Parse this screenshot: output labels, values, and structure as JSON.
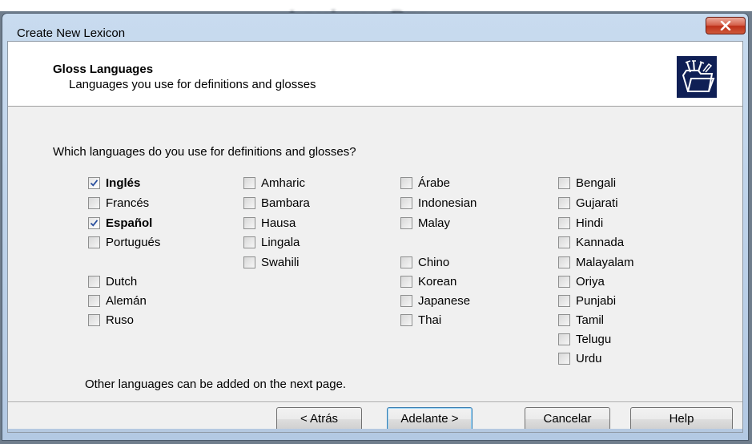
{
  "background": {
    "app_title": "Lexique Pro"
  },
  "window": {
    "title": "Create New Lexicon",
    "close_icon": "close-icon"
  },
  "header": {
    "title": "Gloss Languages",
    "subtitle": "Languages you use for definitions and glosses",
    "icon": "wizard-folder-icon"
  },
  "question": "Which languages do you use for definitions and glosses?",
  "languages": [
    {
      "label": "Inglés",
      "checked": true,
      "bold": true
    },
    {
      "label": "Francés",
      "checked": false
    },
    {
      "label": "Español",
      "checked": true,
      "bold": true
    },
    {
      "label": "Portugués",
      "checked": false
    },
    {
      "label": "Dutch",
      "checked": false
    },
    {
      "label": "Alemán",
      "checked": false
    },
    {
      "label": "Ruso",
      "checked": false
    },
    {
      "label": "Amharic",
      "checked": false
    },
    {
      "label": "Bambara",
      "checked": false
    },
    {
      "label": "Hausa",
      "checked": false
    },
    {
      "label": "Lingala",
      "checked": false
    },
    {
      "label": "Swahili",
      "checked": false
    },
    {
      "label": "Árabe",
      "checked": false
    },
    {
      "label": "Indonesian",
      "checked": false
    },
    {
      "label": "Malay",
      "checked": false
    },
    {
      "label": "Chino",
      "checked": false
    },
    {
      "label": "Korean",
      "checked": false
    },
    {
      "label": "Japanese",
      "checked": false
    },
    {
      "label": "Thai",
      "checked": false
    },
    {
      "label": "Bengali",
      "checked": false
    },
    {
      "label": "Gujarati",
      "checked": false
    },
    {
      "label": "Hindi",
      "checked": false
    },
    {
      "label": "Kannada",
      "checked": false
    },
    {
      "label": "Malayalam",
      "checked": false
    },
    {
      "label": "Oriya",
      "checked": false
    },
    {
      "label": "Punjabi",
      "checked": false
    },
    {
      "label": "Tamil",
      "checked": false
    },
    {
      "label": "Telugu",
      "checked": false
    },
    {
      "label": "Urdu",
      "checked": false
    }
  ],
  "note": "Other languages can be added on the next page.",
  "buttons": {
    "back": "< Atrás",
    "next": "Adelante >",
    "cancel": "Cancelar",
    "help": "Help"
  }
}
